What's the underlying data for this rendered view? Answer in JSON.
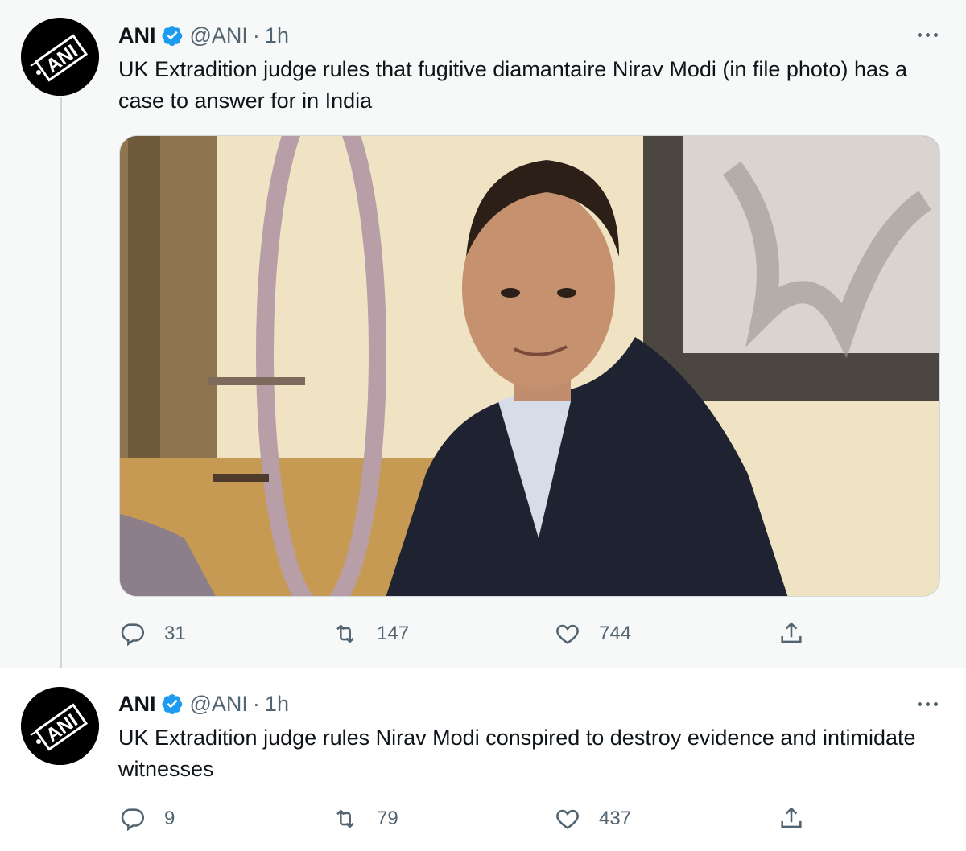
{
  "colors": {
    "verified": "#1d9bf0",
    "text_primary": "#0f1419",
    "text_secondary": "#536471",
    "thread_line": "#cfd9de",
    "tweet1_bg": "#f7f9f9"
  },
  "tweets": [
    {
      "author": {
        "name": "ANI",
        "handle": "@ANI",
        "avatar_text": "ANI",
        "verified_icon": "verified-badge-icon"
      },
      "separator": "·",
      "time": "1h",
      "text": "UK Extradition judge rules that fugitive diamantaire Nirav Modi (in file photo) has a case to answer for in India",
      "media": {
        "type": "photo"
      },
      "actions": {
        "replies": "31",
        "retweets": "147",
        "likes": "744"
      },
      "icons": [
        "reply-icon",
        "retweet-icon",
        "like-icon",
        "share-icon",
        "more-icon"
      ]
    },
    {
      "author": {
        "name": "ANI",
        "handle": "@ANI",
        "avatar_text": "ANI",
        "verified_icon": "verified-badge-icon"
      },
      "separator": "·",
      "time": "1h",
      "text": "UK Extradition judge rules Nirav Modi conspired to destroy evidence and intimidate witnesses",
      "actions": {
        "replies": "9",
        "retweets": "79",
        "likes": "437"
      },
      "icons": [
        "reply-icon",
        "retweet-icon",
        "like-icon",
        "share-icon",
        "more-icon"
      ]
    }
  ]
}
